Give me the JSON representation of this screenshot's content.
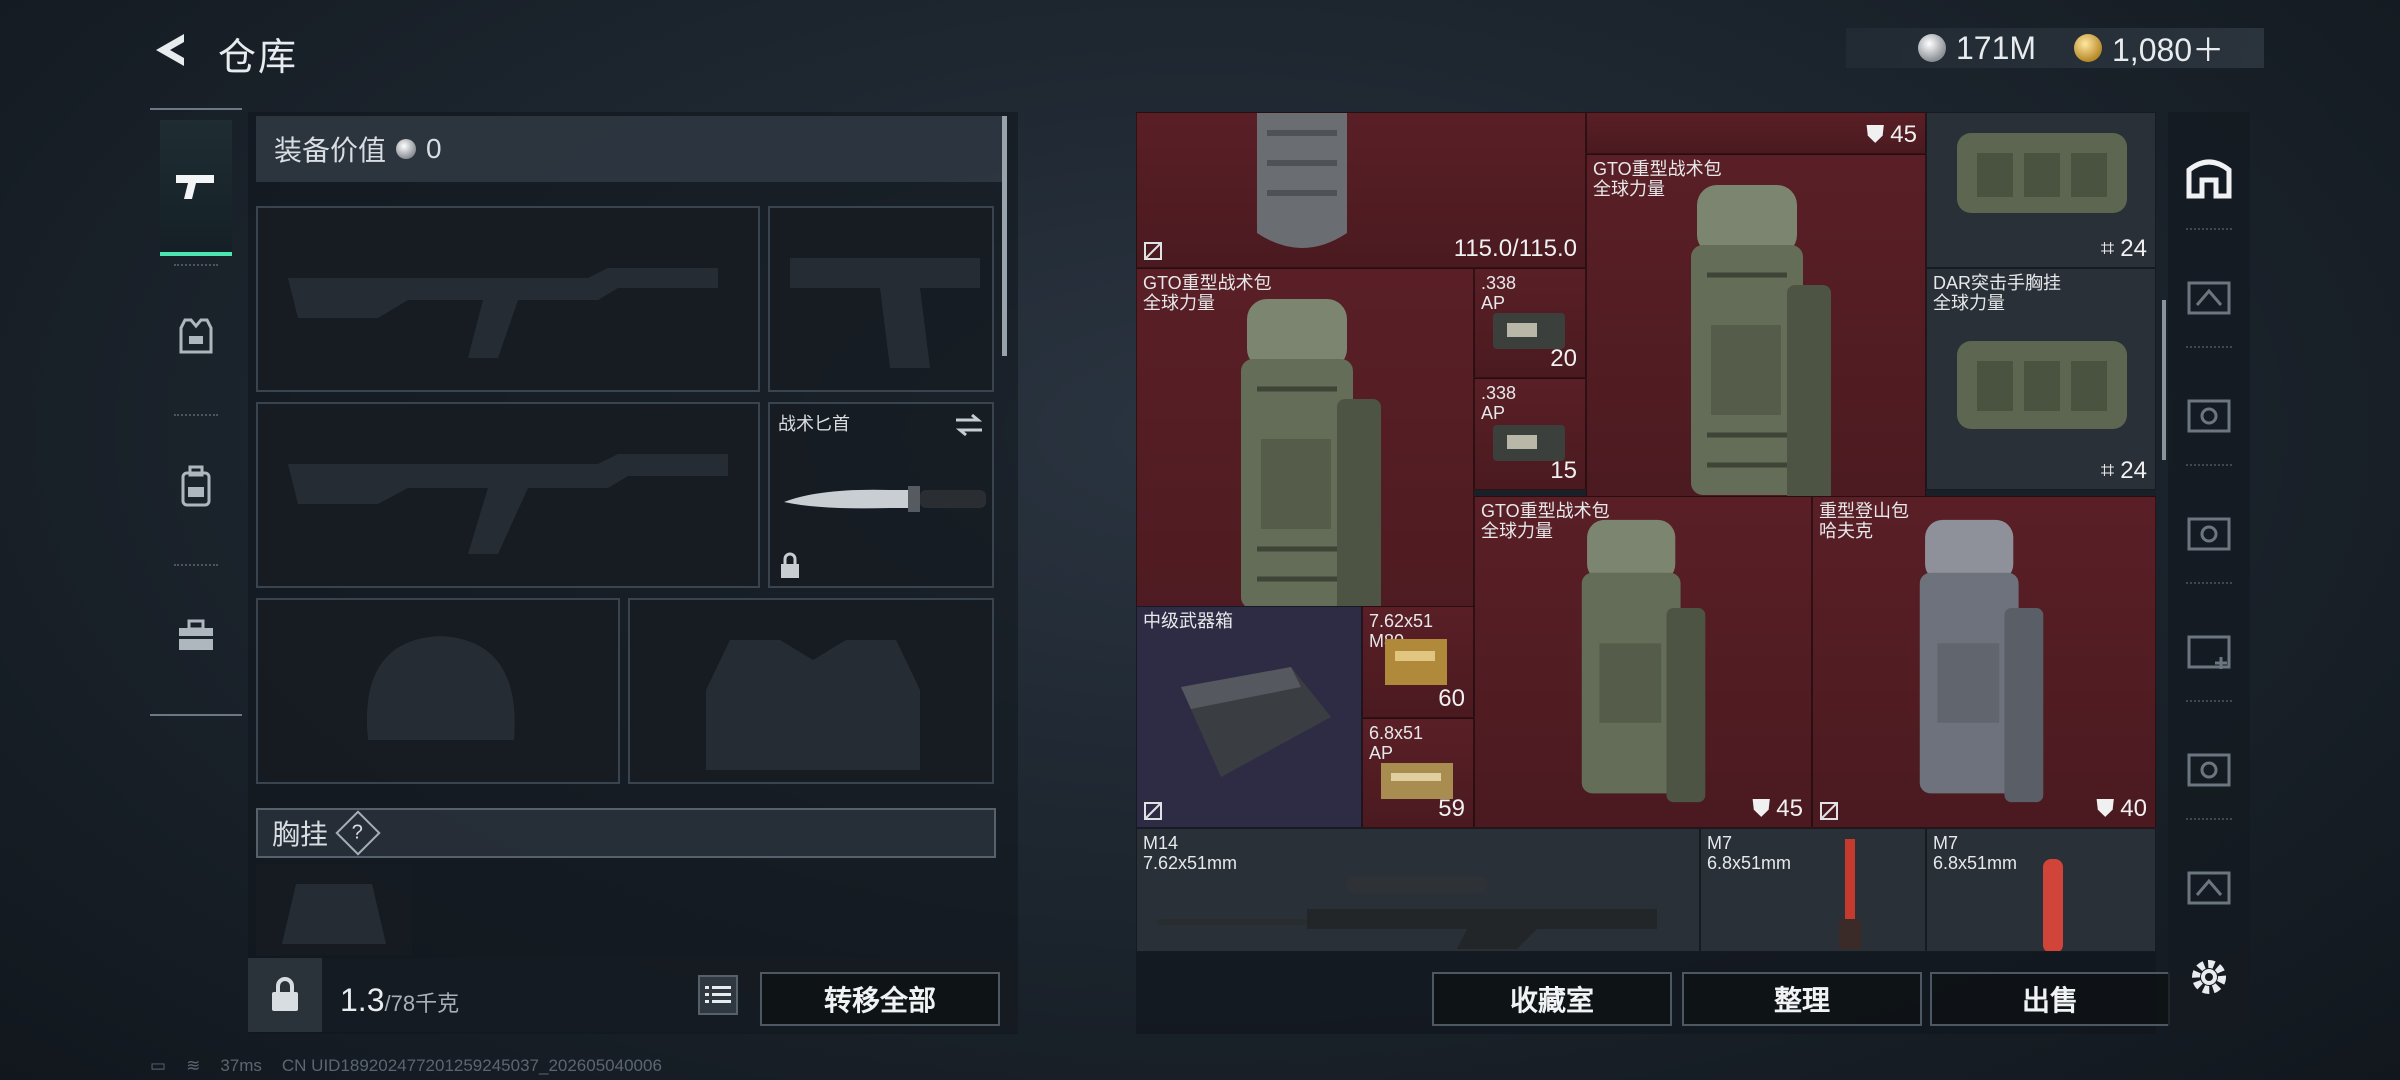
{
  "header": {
    "title": "仓库"
  },
  "currency": {
    "silver": "171M",
    "gold": "1,080＋"
  },
  "equipment": {
    "value_label": "装备价值",
    "value": "0",
    "knife_label": "战术匕首",
    "chest_label": "胸挂",
    "help": "?",
    "weight_current": "1.3",
    "weight_max": "/78千克",
    "transfer_all": "转移全部"
  },
  "storage": {
    "items": [
      {
        "name": "",
        "count": "115.0/115.0"
      },
      {
        "name": "",
        "count": "45"
      },
      {
        "name": "",
        "count": "24"
      },
      {
        "name": "GTO重型战术包\n全球力量",
        "count": "45"
      },
      {
        "name": "GTO重型战术包\n全球力量",
        "count": "45"
      },
      {
        "name": ".338\nAP",
        "count": "20"
      },
      {
        "name": ".338\nAP",
        "count": "15"
      },
      {
        "name": "DAR突击手胸挂\n全球力量",
        "count": "24"
      },
      {
        "name": "GTO重型战术包\n全球力量",
        "count": "45"
      },
      {
        "name": "重型登山包\n哈夫克",
        "count": "40"
      },
      {
        "name": "中级武器箱",
        "count": ""
      },
      {
        "name": "7.62x51\nM80",
        "count": "60"
      },
      {
        "name": "6.8x51\nAP",
        "count": "59"
      },
      {
        "name": "M14\n7.62x51mm",
        "count": ""
      },
      {
        "name": "M7\n6.8x51mm",
        "count": ""
      },
      {
        "name": "M7\n6.8x51mm",
        "count": ""
      }
    ],
    "buttons": {
      "collection": "收藏室",
      "sort": "整理",
      "sell": "出售"
    }
  },
  "status": {
    "ping": "37ms",
    "uid": "CN UID18920247720125924503​7_202605040006"
  },
  "colors": {
    "accent": "#4ee6b0",
    "item_bg": "#4a1a20"
  }
}
